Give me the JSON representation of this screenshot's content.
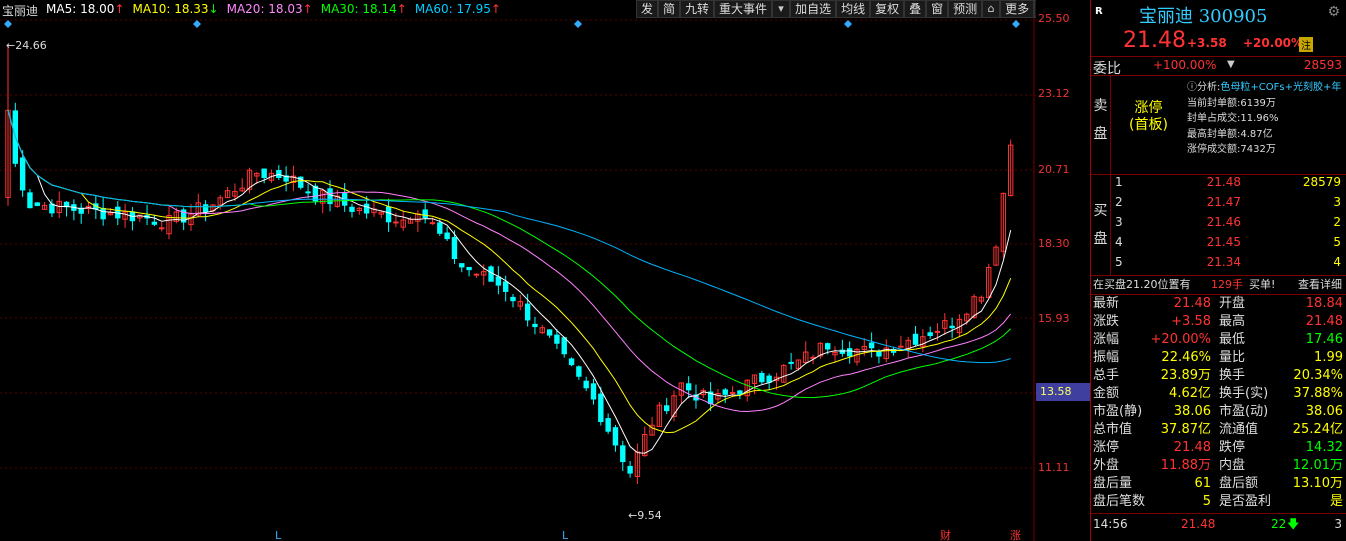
{
  "legend": {
    "name": "宝丽迪",
    "ma5": "MA5: 18.00",
    "ma10": "MA10: 18.33",
    "ma20": "MA20: 18.03",
    "ma30": "MA30: 18.14",
    "ma60": "MA60: 17.95"
  },
  "toolbar": [
    "发",
    "简",
    "九转",
    "重大事件",
    "加自选",
    "均线",
    "复权",
    "叠",
    "窗",
    "预测",
    "更多"
  ],
  "price_axis": [
    "25.50",
    "23.12",
    "20.71",
    "18.30",
    "15.93",
    "13.58",
    "11.11"
  ],
  "marks": {
    "high": "24.66",
    "low": "9.54",
    "l1": "L",
    "l2": "L",
    "cai": "财",
    "zhang": "涨"
  },
  "colors": {
    "up": "#ff3232",
    "down": "#00ffff",
    "ma5": "#ffffff",
    "ma10": "#ffff00",
    "ma20": "#ff80ff",
    "ma30": "#00ff00",
    "ma60": "#00b4ff"
  },
  "header": {
    "r": "R",
    "name": "宝丽迪 300905",
    "price": "21.48",
    "change": "+3.58",
    "pct": "+20.00%",
    "tag": "注"
  },
  "weibi": {
    "label": "委比",
    "value": "+100.00%",
    "diff": "28593"
  },
  "sell": {
    "side": "卖盘",
    "limit_up": "涨停",
    "first_board": "(首板)",
    "analysis_label": "分析:",
    "analysis_value": "色母粒+COFs+光刻胶+年",
    "lines": [
      "当前封单额:6139万",
      "封单占成交:11.96%",
      "最高封单额:4.87亿",
      "涨停成交额:7432万"
    ]
  },
  "buy": {
    "side": "买盘",
    "rows": [
      {
        "level": "1",
        "price": "21.48",
        "vol": "28579"
      },
      {
        "level": "2",
        "price": "21.47",
        "vol": "3"
      },
      {
        "level": "3",
        "price": "21.46",
        "vol": "2"
      },
      {
        "level": "4",
        "price": "21.45",
        "vol": "5"
      },
      {
        "level": "5",
        "price": "21.34",
        "vol": "4"
      }
    ]
  },
  "infobar": {
    "text": "在买盘21.20位置有",
    "count": "129手",
    "action": "买单!",
    "link": "查看详细"
  },
  "stats": [
    {
      "l1": "最新",
      "v1": "21.48",
      "l2": "开盘",
      "v2": "18.84"
    },
    {
      "l1": "涨跌",
      "v1": "+3.58",
      "l2": "最高",
      "v2": "21.48"
    },
    {
      "l1": "涨幅",
      "v1": "+20.00%",
      "l2": "最低",
      "v2": "17.46"
    },
    {
      "l1": "振幅",
      "v1": "22.46%",
      "l2": "量比",
      "v2": "1.99"
    },
    {
      "l1": "总手",
      "v1": "23.89万",
      "l2": "换手",
      "v2": "20.34%"
    },
    {
      "l1": "金额",
      "v1": "4.62亿",
      "l2": "换手(实)",
      "v2": "37.88%"
    },
    {
      "l1": "市盈(静)",
      "v1": "38.06",
      "l2": "市盈(动)",
      "v2": "38.06"
    },
    {
      "l1": "总市值",
      "v1": "37.87亿",
      "l2": "流通值",
      "v2": "25.24亿"
    },
    {
      "l1": "涨停",
      "v1": "21.48",
      "l2": "跌停",
      "v2": "14.32"
    },
    {
      "l1": "外盘",
      "v1": "11.88万",
      "l2": "内盘",
      "v2": "12.01万"
    },
    {
      "l1": "盘后量",
      "v1": "61",
      "l2": "盘后额",
      "v2": "13.10万"
    },
    {
      "l1": "盘后笔数",
      "v1": "5",
      "l2": "是否盈利",
      "v2": "是"
    }
  ],
  "tick": {
    "time": "14:56",
    "price": "21.48",
    "vol": "22",
    "dir": "3"
  }
}
